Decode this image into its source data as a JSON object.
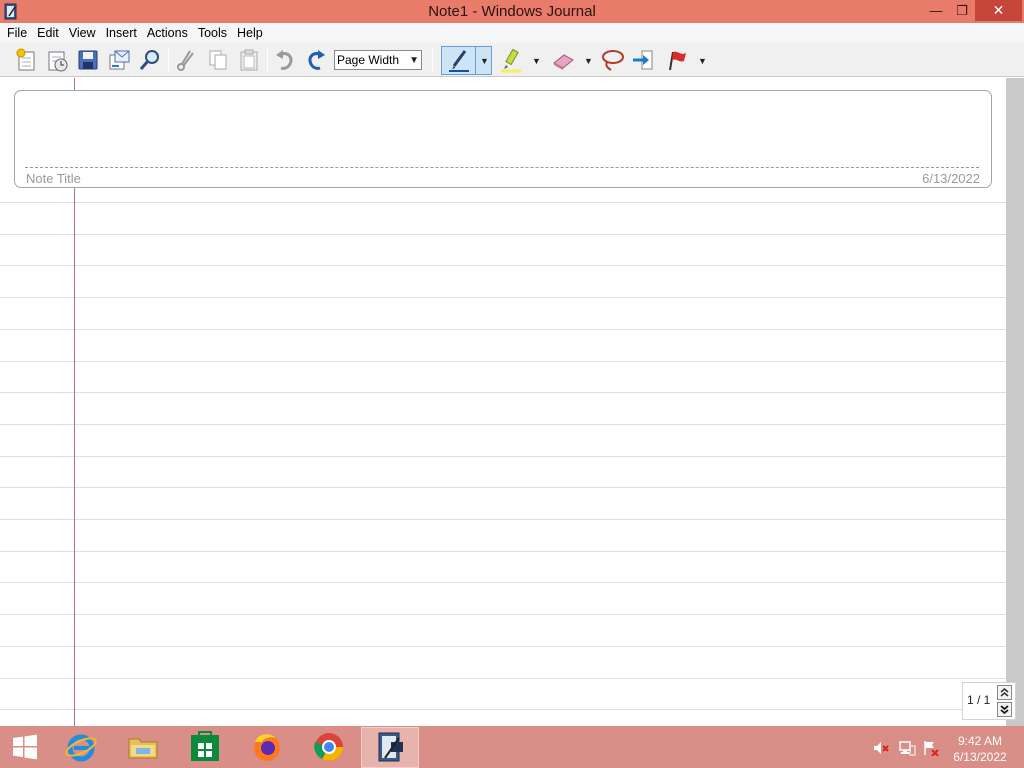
{
  "window": {
    "title": "Note1 - Windows Journal",
    "min_glyph": "—",
    "max_glyph": "❐",
    "close_glyph": "✕"
  },
  "menu": [
    "File",
    "Edit",
    "View",
    "Insert",
    "Actions",
    "Tools",
    "Help"
  ],
  "toolbar": {
    "buttons": [
      "new-note",
      "new-from-template",
      "save",
      "send-email",
      "find",
      "cut",
      "copy",
      "paste",
      "undo",
      "redo"
    ],
    "zoom_value": "Page Width",
    "pen_tools": [
      "pen",
      "highlighter",
      "eraser",
      "lasso-select",
      "insert-space",
      "flag"
    ]
  },
  "note": {
    "title_label": "Note Title",
    "date": "6/13/2022"
  },
  "page_indicator": "1 / 1",
  "taskbar": {
    "apps": [
      "start",
      "internet-explorer",
      "file-explorer",
      "store",
      "firefox",
      "chrome",
      "windows-journal"
    ],
    "clock_time": "9:42 AM",
    "clock_date": "6/13/2022"
  },
  "colors": {
    "titlebar": "#e97b6a",
    "taskbar": "#d98e87",
    "margin_line": "#c46b8d",
    "ruled_line": "#cfe3ee"
  }
}
